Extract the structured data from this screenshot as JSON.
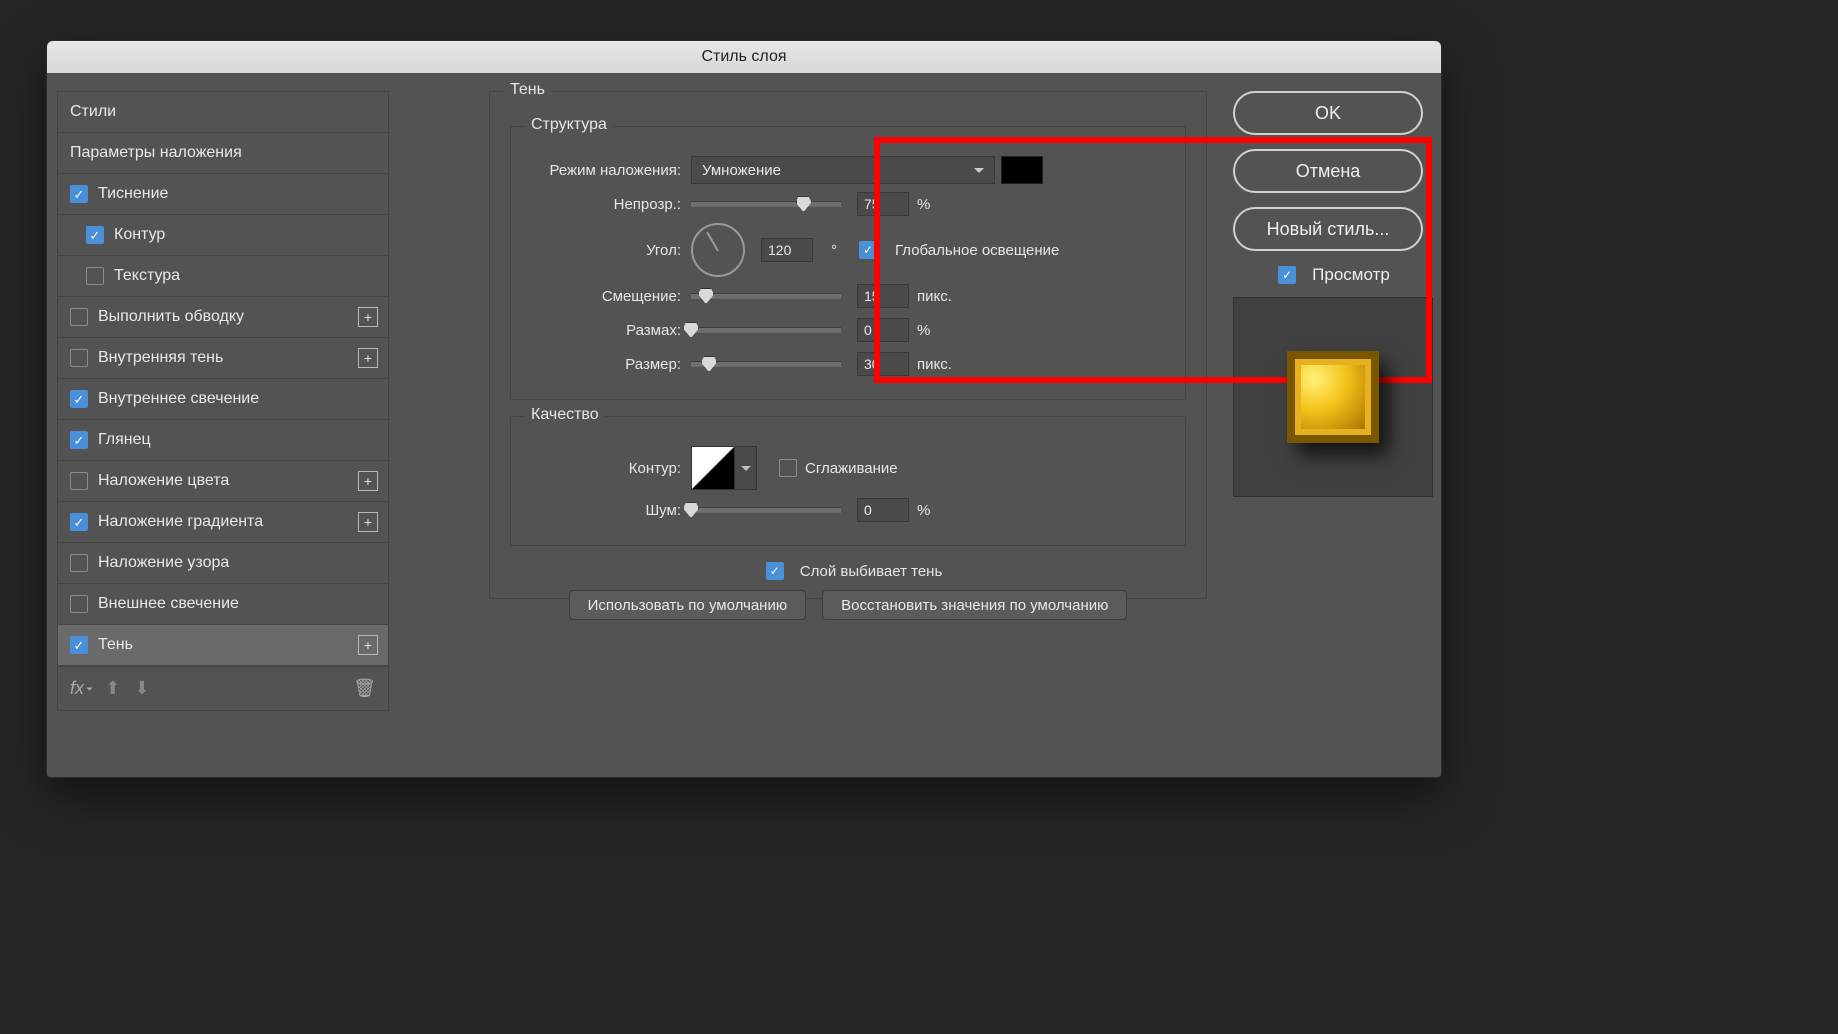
{
  "title": "Стиль слоя",
  "sidebar": {
    "styles_label": "Стили",
    "blend_options_label": "Параметры наложения",
    "items": [
      {
        "label": "Тиснение",
        "checked": true,
        "indent": false,
        "plus": false
      },
      {
        "label": "Контур",
        "checked": true,
        "indent": true,
        "plus": false
      },
      {
        "label": "Текстура",
        "checked": false,
        "indent": true,
        "plus": false
      },
      {
        "label": "Выполнить обводку",
        "checked": false,
        "indent": false,
        "plus": true
      },
      {
        "label": "Внутренняя тень",
        "checked": false,
        "indent": false,
        "plus": true
      },
      {
        "label": "Внутреннее свечение",
        "checked": true,
        "indent": false,
        "plus": false
      },
      {
        "label": "Глянец",
        "checked": true,
        "indent": false,
        "plus": false
      },
      {
        "label": "Наложение цвета",
        "checked": false,
        "indent": false,
        "plus": true
      },
      {
        "label": "Наложение градиента",
        "checked": true,
        "indent": false,
        "plus": true
      },
      {
        "label": "Наложение узора",
        "checked": false,
        "indent": false,
        "plus": false
      },
      {
        "label": "Внешнее свечение",
        "checked": false,
        "indent": false,
        "plus": false
      },
      {
        "label": "Тень",
        "checked": true,
        "indent": false,
        "plus": true,
        "selected": true
      }
    ]
  },
  "panel": {
    "shadow_legend": "Тень",
    "structure_legend": "Структура",
    "quality_legend": "Качество",
    "blend_mode_label": "Режим наложения:",
    "blend_mode_value": "Умножение",
    "shadow_color": "#000000",
    "opacity_label": "Непрозр.:",
    "opacity_value": "75",
    "percent": "%",
    "angle_label": "Угол:",
    "angle_value": "120",
    "degree": "°",
    "global_light_label": "Глобальное освещение",
    "global_light_checked": true,
    "distance_label": "Смещение:",
    "distance_value": "15",
    "px": "пикс.",
    "spread_label": "Размах:",
    "spread_value": "0",
    "size_label": "Размер:",
    "size_value": "30",
    "contour_label": "Контур:",
    "antialias_label": "Сглаживание",
    "antialias_checked": false,
    "noise_label": "Шум:",
    "noise_value": "0",
    "knockout_label": "Слой выбивает тень",
    "knockout_checked": true,
    "make_default": "Использовать по умолчанию",
    "reset_default": "Восстановить значения по умолчанию"
  },
  "buttons": {
    "ok": "OK",
    "cancel": "Отмена",
    "new_style": "Новый стиль...",
    "preview": "Просмотр",
    "preview_checked": true
  }
}
